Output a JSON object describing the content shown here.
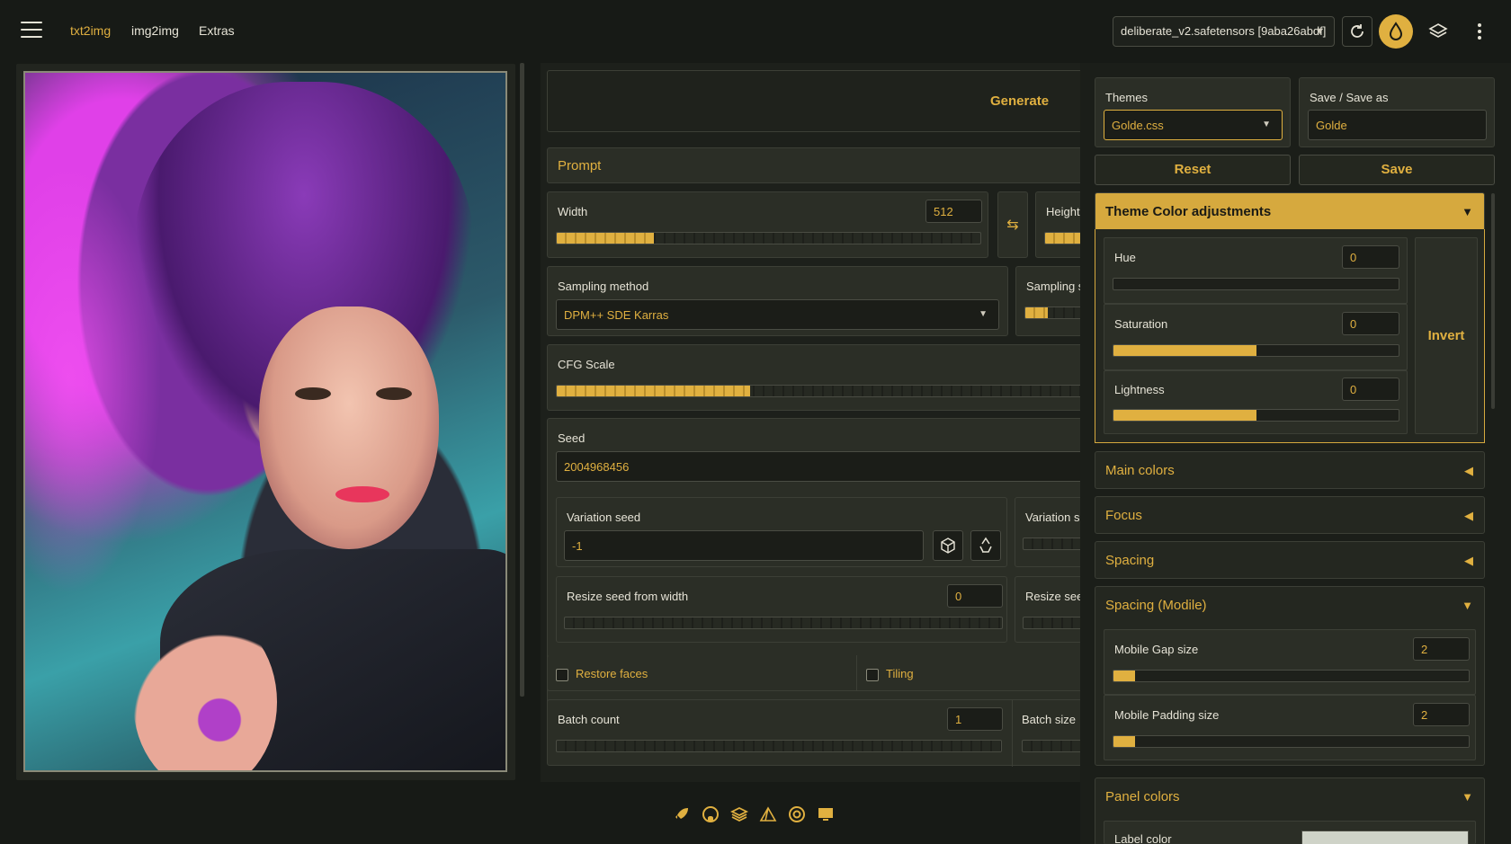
{
  "nav": {
    "tabs": [
      {
        "label": "txt2img",
        "active": true
      },
      {
        "label": "img2img",
        "active": false
      },
      {
        "label": "Extras",
        "active": false
      }
    ]
  },
  "model": {
    "selected": "deliberate_v2.safetensors [9aba26abdf]"
  },
  "topicons": [
    "refresh-icon",
    "theme-drop-icon",
    "layers-icon",
    "kebab-menu-icon"
  ],
  "generate": {
    "label": "Generate"
  },
  "prompt": {
    "label": "Prompt"
  },
  "width": {
    "label": "Width",
    "value": "512",
    "fraction": 0.23
  },
  "height": {
    "label": "Height"
  },
  "sampling": {
    "label": "Sampling method",
    "value": "DPM++ SDE Karras"
  },
  "sampling_steps": {
    "label": "Sampling s"
  },
  "cfg": {
    "label": "CFG Scale",
    "fraction": 0.36
  },
  "seed": {
    "label": "Seed",
    "value": "2004968456"
  },
  "variation_seed": {
    "label": "Variation seed",
    "value": "-1"
  },
  "variation_strength": {
    "label": "Variation s"
  },
  "resize_seed_width": {
    "label": "Resize seed from width",
    "value": "0"
  },
  "resize_seed_height": {
    "label": "Resize seed"
  },
  "restore_faces": {
    "label": "Restore faces"
  },
  "tiling": {
    "label": "Tiling"
  },
  "batch_count": {
    "label": "Batch count",
    "value": "1"
  },
  "batch_size": {
    "label": "Batch size"
  },
  "themes": {
    "label": "Themes",
    "value": "Golde.css"
  },
  "save_as": {
    "label": "Save / Save as",
    "value": "Golde"
  },
  "reset": {
    "label": "Reset"
  },
  "save": {
    "label": "Save"
  },
  "theme_color": {
    "title": "Theme Color adjustments",
    "hue": {
      "label": "Hue",
      "value": "0",
      "fraction": 0
    },
    "saturation": {
      "label": "Saturation",
      "value": "0",
      "fraction": 0.5
    },
    "lightness": {
      "label": "Lightness",
      "value": "0",
      "fraction": 0.5
    },
    "invert": "Invert"
  },
  "accordions": {
    "main_colors": "Main colors",
    "focus": "Focus",
    "spacing": "Spacing",
    "spacing_mobile": "Spacing (Modile)",
    "panel_colors": "Panel colors"
  },
  "mobile": {
    "gap": {
      "label": "Mobile Gap size",
      "value": "2",
      "fraction": 0.06
    },
    "padding": {
      "label": "Mobile Padding size",
      "value": "2",
      "fraction": 0.06
    }
  },
  "label_color": {
    "label": "Label color"
  },
  "footer_icons": [
    "rocket-icon",
    "github-icon",
    "stack-icon",
    "triangle-icon",
    "copyright-icon",
    "monitor-icon"
  ],
  "colors": {
    "accent": "#e0b040",
    "background": "#171a16",
    "panel": "#2b2e26"
  }
}
